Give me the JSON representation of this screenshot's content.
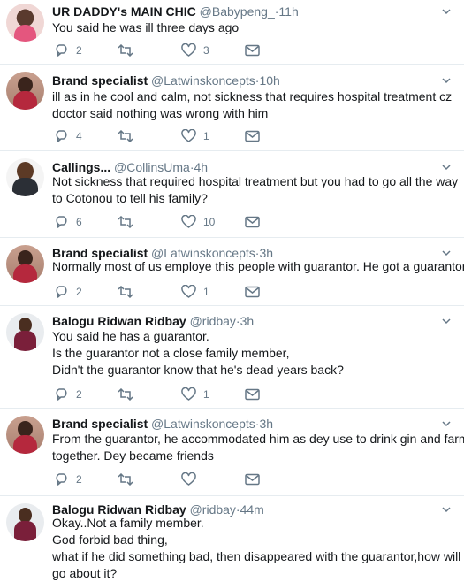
{
  "tweets": [
    {
      "name": "UR DADDY's MAIN CHIC",
      "handle": "@Babypeng_",
      "time": "11h",
      "avatar": "profile-photo",
      "lines": [
        "You said he was ill three days ago"
      ],
      "replies": "2",
      "retweets": "",
      "likes": "3"
    },
    {
      "name": "Brand specialist",
      "handle": "@Latwinskoncepts",
      "time": "10h",
      "avatar": "profile-photo",
      "lines": [
        "ill as in he cool and calm, not sickness that requires hospital treatment cz",
        "doctor said nothing was wrong with him"
      ],
      "replies": "4",
      "retweets": "",
      "likes": "1"
    },
    {
      "name": "Callings...",
      "handle": "@CollinsUma",
      "time": "4h",
      "avatar": "profile-photo",
      "lines": [
        "Not sickness that required hospital treatment but you had to go all the way",
        "to Cotonou to tell his family?"
      ],
      "replies": "6",
      "retweets": "",
      "likes": "10"
    },
    {
      "name": "Brand specialist",
      "handle": "@Latwinskoncepts",
      "time": "3h",
      "avatar": "profile-photo",
      "lines": [
        "Normally most of us employe this people with guarantor. He got a guarantor"
      ],
      "replies": "2",
      "retweets": "",
      "likes": "1"
    },
    {
      "name": "Balogu Ridwan Ridbay",
      "handle": "@ridbay",
      "time": "3h",
      "avatar": "profile-photo",
      "lines": [
        "You said he has a guarantor.",
        "Is the guarantor not a close family member,",
        "Didn't the guarantor know that he's dead years back?"
      ],
      "replies": "2",
      "retweets": "",
      "likes": "1"
    },
    {
      "name": "Brand specialist",
      "handle": "@Latwinskoncepts",
      "time": "3h",
      "avatar": "profile-photo",
      "lines": [
        "From the guarantor, he accommodated him as dey use to drink gin and farm",
        "together. Dey became friends"
      ],
      "replies": "2",
      "retweets": "",
      "likes": ""
    },
    {
      "name": "Balogu Ridwan Ridbay",
      "handle": "@ridbay",
      "time": "44m",
      "avatar": "profile-photo",
      "lines": [
        "Okay..Not a family member.",
        "God forbid bad thing,",
        "what if he did something bad, then disappeared with the guarantor,how will you",
        "go about it?"
      ],
      "replies": "",
      "retweets": "",
      "likes": ""
    }
  ],
  "separator": "·",
  "colors": {
    "icon": "#657786",
    "thread_line": "#c4cfd6",
    "divider": "#e6ecf0"
  },
  "icons": {
    "reply": "reply-icon",
    "retweet": "retweet-icon",
    "like": "heart-icon",
    "dm": "envelope-icon",
    "menu": "chevron-down-icon"
  }
}
